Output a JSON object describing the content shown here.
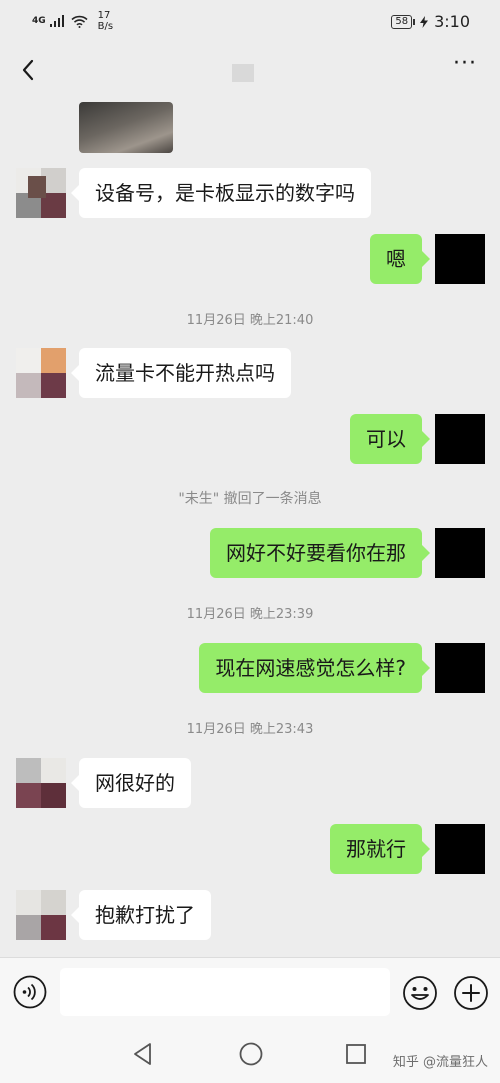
{
  "status_bar": {
    "network": "4G",
    "speed_value": "17",
    "speed_unit": "B/s",
    "battery": "58",
    "time": "3:10"
  },
  "nav": {
    "back_icon": "chevron-left-icon",
    "more_icon": "ellipsis-icon",
    "more_label": "···"
  },
  "messages": [
    {
      "type": "image",
      "side": "in"
    },
    {
      "type": "text",
      "side": "in",
      "text": "设备号，是卡板显示的数字吗"
    },
    {
      "type": "text",
      "side": "out",
      "text": "嗯"
    },
    {
      "type": "time",
      "text": "11月26日 晚上21:40"
    },
    {
      "type": "text",
      "side": "in",
      "text": "流量卡不能开热点吗"
    },
    {
      "type": "text",
      "side": "out",
      "text": "可以"
    },
    {
      "type": "system",
      "text": "\"未生\" 撤回了一条消息"
    },
    {
      "type": "text",
      "side": "out",
      "text": "网好不好要看你在那"
    },
    {
      "type": "time",
      "text": "11月26日 晚上23:39"
    },
    {
      "type": "text",
      "side": "out",
      "text": "现在网速感觉怎么样?"
    },
    {
      "type": "time",
      "text": "11月26日 晚上23:43"
    },
    {
      "type": "text",
      "side": "in",
      "text": "网很好的"
    },
    {
      "type": "text",
      "side": "out",
      "text": "那就行"
    },
    {
      "type": "text",
      "side": "in",
      "text": "抱歉打扰了"
    }
  ],
  "input_bar": {
    "value": "",
    "voice_icon": "voice-icon",
    "emoji_icon": "emoji-icon",
    "plus_icon": "plus-icon"
  },
  "system_nav": {
    "watermark": "知乎 @流量狂人"
  },
  "colors": {
    "outgoing_bubble": "#95ec69",
    "incoming_bubble": "#ffffff",
    "background": "#ededed"
  }
}
